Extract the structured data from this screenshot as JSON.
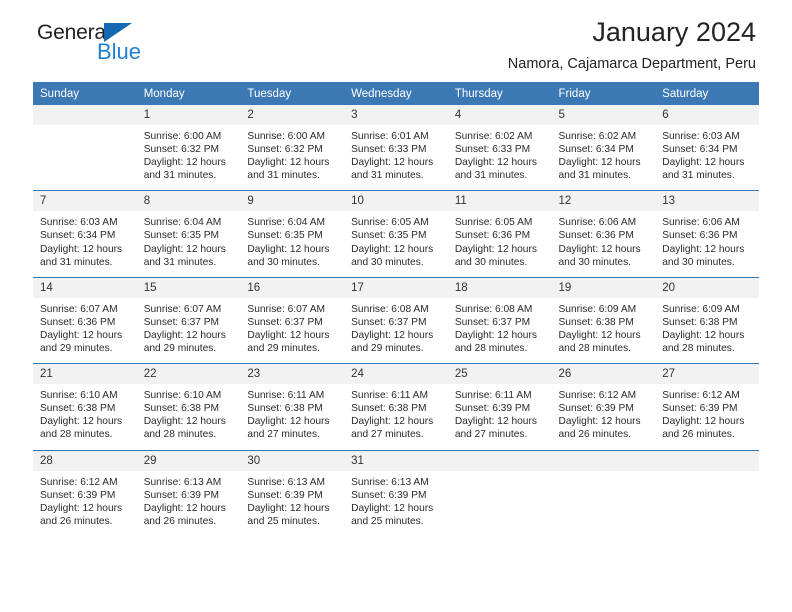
{
  "brand": {
    "name_part1": "General",
    "name_part2": "Blue",
    "accent_color": "#1f7fd0",
    "triangle_color": "#1268b3"
  },
  "header": {
    "title": "January 2024",
    "location": "Namora, Cajamarca Department, Peru",
    "header_bg": "#3b78b4",
    "daynum_bg": "#f2f2f2"
  },
  "columns": [
    "Sunday",
    "Monday",
    "Tuesday",
    "Wednesday",
    "Thursday",
    "Friday",
    "Saturday"
  ],
  "weeks": [
    [
      {
        "day": "",
        "sunrise": "",
        "sunset": "",
        "daylight_line1": "",
        "daylight_line2": ""
      },
      {
        "day": "1",
        "sunrise": "Sunrise: 6:00 AM",
        "sunset": "Sunset: 6:32 PM",
        "daylight_line1": "Daylight: 12 hours",
        "daylight_line2": "and 31 minutes."
      },
      {
        "day": "2",
        "sunrise": "Sunrise: 6:00 AM",
        "sunset": "Sunset: 6:32 PM",
        "daylight_line1": "Daylight: 12 hours",
        "daylight_line2": "and 31 minutes."
      },
      {
        "day": "3",
        "sunrise": "Sunrise: 6:01 AM",
        "sunset": "Sunset: 6:33 PM",
        "daylight_line1": "Daylight: 12 hours",
        "daylight_line2": "and 31 minutes."
      },
      {
        "day": "4",
        "sunrise": "Sunrise: 6:02 AM",
        "sunset": "Sunset: 6:33 PM",
        "daylight_line1": "Daylight: 12 hours",
        "daylight_line2": "and 31 minutes."
      },
      {
        "day": "5",
        "sunrise": "Sunrise: 6:02 AM",
        "sunset": "Sunset: 6:34 PM",
        "daylight_line1": "Daylight: 12 hours",
        "daylight_line2": "and 31 minutes."
      },
      {
        "day": "6",
        "sunrise": "Sunrise: 6:03 AM",
        "sunset": "Sunset: 6:34 PM",
        "daylight_line1": "Daylight: 12 hours",
        "daylight_line2": "and 31 minutes."
      }
    ],
    [
      {
        "day": "7",
        "sunrise": "Sunrise: 6:03 AM",
        "sunset": "Sunset: 6:34 PM",
        "daylight_line1": "Daylight: 12 hours",
        "daylight_line2": "and 31 minutes."
      },
      {
        "day": "8",
        "sunrise": "Sunrise: 6:04 AM",
        "sunset": "Sunset: 6:35 PM",
        "daylight_line1": "Daylight: 12 hours",
        "daylight_line2": "and 31 minutes."
      },
      {
        "day": "9",
        "sunrise": "Sunrise: 6:04 AM",
        "sunset": "Sunset: 6:35 PM",
        "daylight_line1": "Daylight: 12 hours",
        "daylight_line2": "and 30 minutes."
      },
      {
        "day": "10",
        "sunrise": "Sunrise: 6:05 AM",
        "sunset": "Sunset: 6:35 PM",
        "daylight_line1": "Daylight: 12 hours",
        "daylight_line2": "and 30 minutes."
      },
      {
        "day": "11",
        "sunrise": "Sunrise: 6:05 AM",
        "sunset": "Sunset: 6:36 PM",
        "daylight_line1": "Daylight: 12 hours",
        "daylight_line2": "and 30 minutes."
      },
      {
        "day": "12",
        "sunrise": "Sunrise: 6:06 AM",
        "sunset": "Sunset: 6:36 PM",
        "daylight_line1": "Daylight: 12 hours",
        "daylight_line2": "and 30 minutes."
      },
      {
        "day": "13",
        "sunrise": "Sunrise: 6:06 AM",
        "sunset": "Sunset: 6:36 PM",
        "daylight_line1": "Daylight: 12 hours",
        "daylight_line2": "and 30 minutes."
      }
    ],
    [
      {
        "day": "14",
        "sunrise": "Sunrise: 6:07 AM",
        "sunset": "Sunset: 6:36 PM",
        "daylight_line1": "Daylight: 12 hours",
        "daylight_line2": "and 29 minutes."
      },
      {
        "day": "15",
        "sunrise": "Sunrise: 6:07 AM",
        "sunset": "Sunset: 6:37 PM",
        "daylight_line1": "Daylight: 12 hours",
        "daylight_line2": "and 29 minutes."
      },
      {
        "day": "16",
        "sunrise": "Sunrise: 6:07 AM",
        "sunset": "Sunset: 6:37 PM",
        "daylight_line1": "Daylight: 12 hours",
        "daylight_line2": "and 29 minutes."
      },
      {
        "day": "17",
        "sunrise": "Sunrise: 6:08 AM",
        "sunset": "Sunset: 6:37 PM",
        "daylight_line1": "Daylight: 12 hours",
        "daylight_line2": "and 29 minutes."
      },
      {
        "day": "18",
        "sunrise": "Sunrise: 6:08 AM",
        "sunset": "Sunset: 6:37 PM",
        "daylight_line1": "Daylight: 12 hours",
        "daylight_line2": "and 28 minutes."
      },
      {
        "day": "19",
        "sunrise": "Sunrise: 6:09 AM",
        "sunset": "Sunset: 6:38 PM",
        "daylight_line1": "Daylight: 12 hours",
        "daylight_line2": "and 28 minutes."
      },
      {
        "day": "20",
        "sunrise": "Sunrise: 6:09 AM",
        "sunset": "Sunset: 6:38 PM",
        "daylight_line1": "Daylight: 12 hours",
        "daylight_line2": "and 28 minutes."
      }
    ],
    [
      {
        "day": "21",
        "sunrise": "Sunrise: 6:10 AM",
        "sunset": "Sunset: 6:38 PM",
        "daylight_line1": "Daylight: 12 hours",
        "daylight_line2": "and 28 minutes."
      },
      {
        "day": "22",
        "sunrise": "Sunrise: 6:10 AM",
        "sunset": "Sunset: 6:38 PM",
        "daylight_line1": "Daylight: 12 hours",
        "daylight_line2": "and 28 minutes."
      },
      {
        "day": "23",
        "sunrise": "Sunrise: 6:11 AM",
        "sunset": "Sunset: 6:38 PM",
        "daylight_line1": "Daylight: 12 hours",
        "daylight_line2": "and 27 minutes."
      },
      {
        "day": "24",
        "sunrise": "Sunrise: 6:11 AM",
        "sunset": "Sunset: 6:38 PM",
        "daylight_line1": "Daylight: 12 hours",
        "daylight_line2": "and 27 minutes."
      },
      {
        "day": "25",
        "sunrise": "Sunrise: 6:11 AM",
        "sunset": "Sunset: 6:39 PM",
        "daylight_line1": "Daylight: 12 hours",
        "daylight_line2": "and 27 minutes."
      },
      {
        "day": "26",
        "sunrise": "Sunrise: 6:12 AM",
        "sunset": "Sunset: 6:39 PM",
        "daylight_line1": "Daylight: 12 hours",
        "daylight_line2": "and 26 minutes."
      },
      {
        "day": "27",
        "sunrise": "Sunrise: 6:12 AM",
        "sunset": "Sunset: 6:39 PM",
        "daylight_line1": "Daylight: 12 hours",
        "daylight_line2": "and 26 minutes."
      }
    ],
    [
      {
        "day": "28",
        "sunrise": "Sunrise: 6:12 AM",
        "sunset": "Sunset: 6:39 PM",
        "daylight_line1": "Daylight: 12 hours",
        "daylight_line2": "and 26 minutes."
      },
      {
        "day": "29",
        "sunrise": "Sunrise: 6:13 AM",
        "sunset": "Sunset: 6:39 PM",
        "daylight_line1": "Daylight: 12 hours",
        "daylight_line2": "and 26 minutes."
      },
      {
        "day": "30",
        "sunrise": "Sunrise: 6:13 AM",
        "sunset": "Sunset: 6:39 PM",
        "daylight_line1": "Daylight: 12 hours",
        "daylight_line2": "and 25 minutes."
      },
      {
        "day": "31",
        "sunrise": "Sunrise: 6:13 AM",
        "sunset": "Sunset: 6:39 PM",
        "daylight_line1": "Daylight: 12 hours",
        "daylight_line2": "and 25 minutes."
      },
      {
        "day": "",
        "sunrise": "",
        "sunset": "",
        "daylight_line1": "",
        "daylight_line2": ""
      },
      {
        "day": "",
        "sunrise": "",
        "sunset": "",
        "daylight_line1": "",
        "daylight_line2": ""
      },
      {
        "day": "",
        "sunrise": "",
        "sunset": "",
        "daylight_line1": "",
        "daylight_line2": ""
      }
    ]
  ]
}
